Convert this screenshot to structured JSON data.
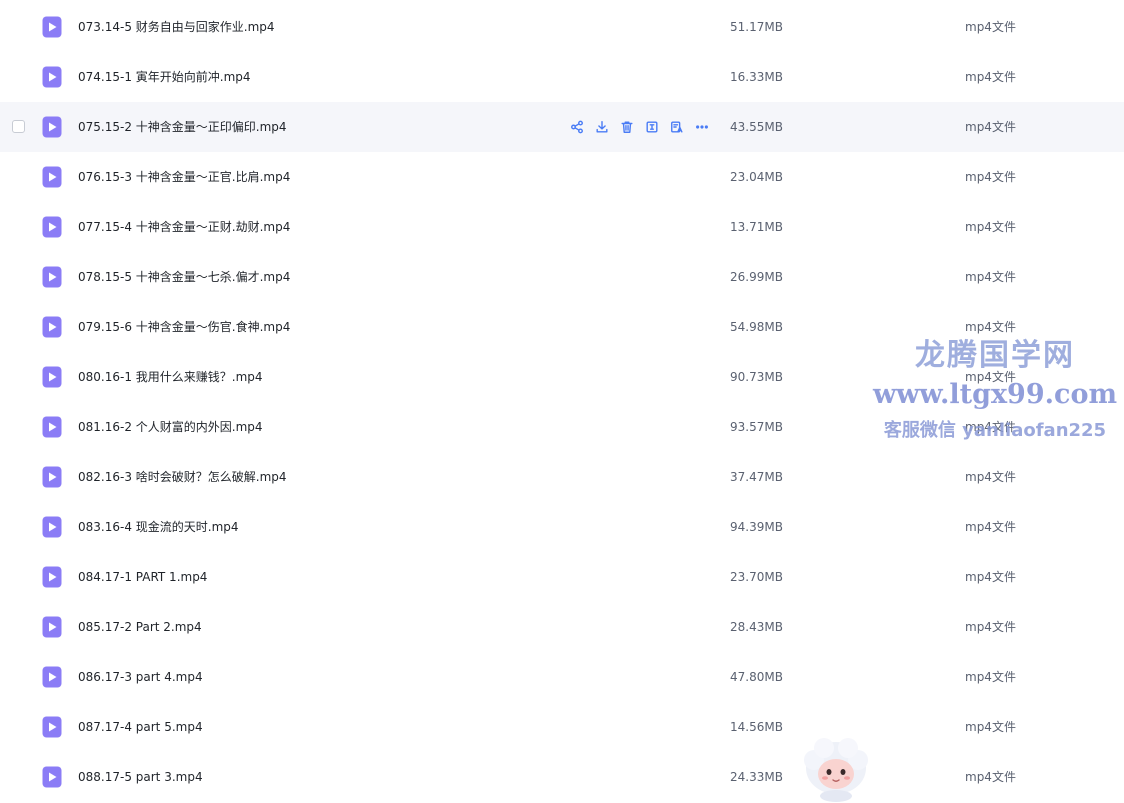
{
  "files": [
    {
      "name": "073.14-5 财务自由与回家作业.mp4",
      "size": "51.17MB",
      "type": "mp4文件"
    },
    {
      "name": "074.15-1 寅年开始向前冲.mp4",
      "size": "16.33MB",
      "type": "mp4文件"
    },
    {
      "name": "075.15-2 十神含金量～正印偏印.mp4",
      "size": "43.55MB",
      "type": "mp4文件",
      "hovered": true
    },
    {
      "name": "076.15-3 十神含金量～正官.比肩.mp4",
      "size": "23.04MB",
      "type": "mp4文件"
    },
    {
      "name": "077.15-4 十神含金量～正财.劫财.mp4",
      "size": "13.71MB",
      "type": "mp4文件"
    },
    {
      "name": "078.15-5 十神含金量～七杀.偏才.mp4",
      "size": "26.99MB",
      "type": "mp4文件"
    },
    {
      "name": "079.15-6 十神含金量～伤官.食神.mp4",
      "size": "54.98MB",
      "type": "mp4文件"
    },
    {
      "name": "080.16-1 我用什么来赚钱？.mp4",
      "size": "90.73MB",
      "type": "mp4文件"
    },
    {
      "name": "081.16-2 个人财富的内外因.mp4",
      "size": "93.57MB",
      "type": "mp4文件"
    },
    {
      "name": "082.16-3 啥时会破财？怎么破解.mp4",
      "size": "37.47MB",
      "type": "mp4文件"
    },
    {
      "name": "083.16-4 现金流的天时.mp4",
      "size": "94.39MB",
      "type": "mp4文件"
    },
    {
      "name": "084.17-1 PART 1.mp4",
      "size": "23.70MB",
      "type": "mp4文件"
    },
    {
      "name": "085.17-2 Part 2.mp4",
      "size": "28.43MB",
      "type": "mp4文件"
    },
    {
      "name": "086.17-3 part 4.mp4",
      "size": "47.80MB",
      "type": "mp4文件"
    },
    {
      "name": "087.17-4 part 5.mp4",
      "size": "14.56MB",
      "type": "mp4文件"
    },
    {
      "name": "088.17-5 part 3.mp4",
      "size": "24.33MB",
      "type": "mp4文件"
    }
  ],
  "row_actions": [
    "share-icon",
    "download-icon",
    "delete-icon",
    "rename-icon",
    "more-tools-icon",
    "more-icon"
  ],
  "watermark": {
    "title": "龙腾国学网",
    "url": "www.ltgx99.com",
    "contact": "客服微信 yanliaofan225"
  },
  "colors": {
    "file_icon": "#8b7cf6",
    "action_icon": "#4a7cf5",
    "hover_row": "#f5f6fa",
    "watermark": "#8a9ad6"
  }
}
